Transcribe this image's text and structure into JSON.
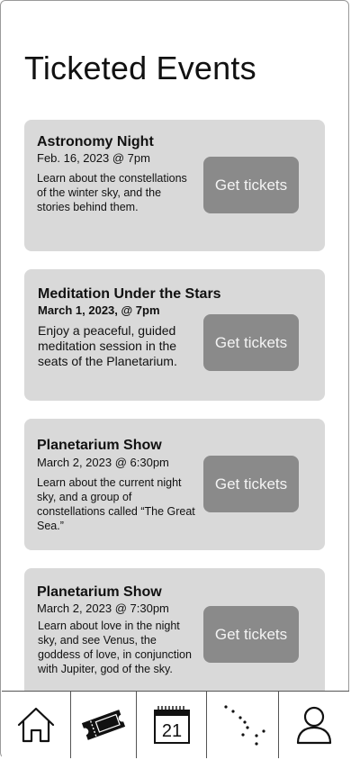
{
  "header": {
    "title": "Ticketed Events"
  },
  "events": [
    {
      "title": "Astronomy Night",
      "date": "Feb. 16, 2023 @ 7pm",
      "description": "Learn about the constellations of the winter sky, and the stories behind them.",
      "button_label": "Get tickets"
    },
    {
      "title": "Meditation Under the Stars",
      "date": "March 1, 2023, @ 7pm",
      "description": "Enjoy a peaceful, guided meditation session in the seats of the Planetarium.",
      "button_label": "Get tickets"
    },
    {
      "title": "Planetarium Show",
      "date": "March 2, 2023 @ 6:30pm",
      "description": "Learn about the current night sky, and a group of constellations called “The Great Sea.”",
      "button_label": "Get tickets"
    },
    {
      "title": "Planetarium Show",
      "date": "March 2, 2023 @ 7:30pm",
      "description": "Learn about love in the night sky, and see Venus, the goddess of love, in conjunction with Jupiter, god of the sky.",
      "button_label": "Get tickets"
    }
  ],
  "tabbar": {
    "tabs": [
      {
        "icon": "home-icon"
      },
      {
        "icon": "ticket-icon"
      },
      {
        "icon": "calendar-icon",
        "calendar_day": "21"
      },
      {
        "icon": "constellation-icon"
      },
      {
        "icon": "profile-icon"
      }
    ]
  }
}
